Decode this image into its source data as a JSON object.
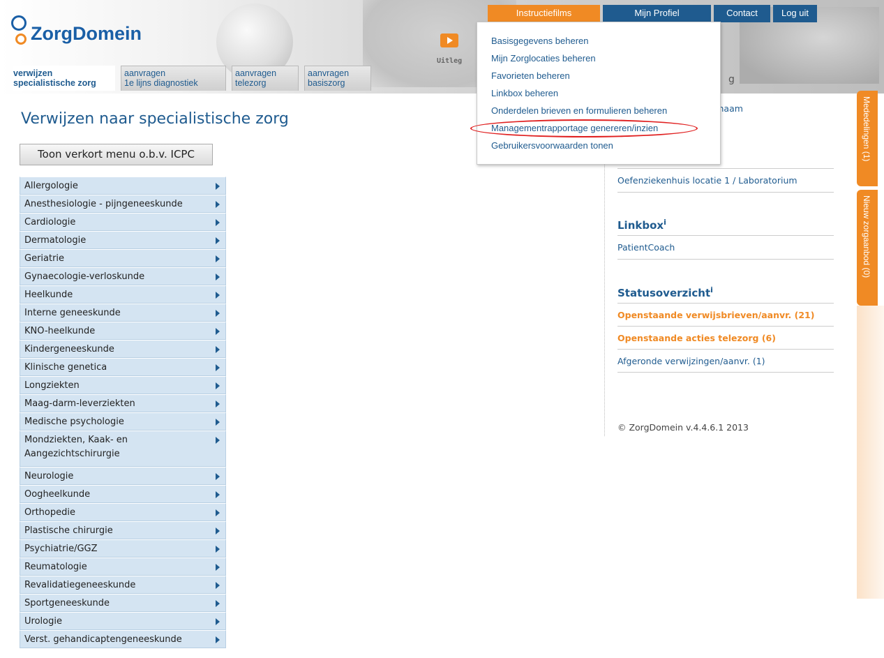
{
  "header": {
    "logo_text": "ZorgDomein",
    "uitleg_label": "Uitleg",
    "nav": {
      "instructiefilms": "Instructiefilms",
      "mijn_profiel": "Mijn Profiel",
      "contact": "Contact",
      "log_uit": "Log uit"
    },
    "tabs": [
      {
        "line1": "verwijzen",
        "line2": "specialistische zorg"
      },
      {
        "line1": "aanvragen",
        "line2": "1e lijns diagnostiek"
      },
      {
        "line1": "aanvragen",
        "line2": "telezorg"
      },
      {
        "line1": "aanvragen",
        "line2": "basiszorg"
      }
    ]
  },
  "main": {
    "title": "Verwijzen naar specialistische zorg",
    "icpc_button": "Toon verkort menu o.b.v. ICPC",
    "specialties": [
      "Allergologie",
      "Anesthesiologie - pijngeneeskunde",
      "Cardiologie",
      "Dermatologie",
      "Geriatrie",
      "Gynaecologie-verloskunde",
      "Heelkunde",
      "Interne geneeskunde",
      "KNO-heelkunde",
      "Kindergeneeskunde",
      "Klinische genetica",
      "Longziekten",
      "Maag-darm-leverziekten",
      "Medische psychologie",
      "Mondziekten, Kaak- en Aangezichtschirurgie",
      "Neurologie",
      "Oogheelkunde",
      "Orthopedie",
      "Plastische chirurgie",
      "Psychiatrie/GGZ",
      "Reumatologie",
      "Revalidatiegeneeskunde",
      "Sportgeneeskunde",
      "Urologie",
      "Verst. gehandicaptengeneeskunde"
    ]
  },
  "profile_menu": {
    "items": [
      "Basisgegevens beheren",
      "Mijn Zorglocaties beheren",
      "Favorieten beheren",
      "Linkbox beheren",
      "Onderdelen brieven en formulieren beheren",
      "Managementrapportage genereren/inzien",
      "Gebruikersvoorwaarden tonen"
    ]
  },
  "sidebar": {
    "partial_top": "snaam",
    "partial_lab_heading": "ek",
    "lab_item": "Oefenziekenhuis locatie 1 / Laboratorium",
    "linkbox_heading": "Linkbox",
    "linkbox_item": "PatientCoach",
    "status_heading": "Statusoverzicht",
    "status_items": [
      "Openstaande verwijsbrieven/aanvr. (21)",
      "Openstaande acties telezorg (6)",
      "Afgeronde verwijzingen/aanvr. (1)"
    ],
    "info_mark": "i",
    "copyright": "© ZorgDomein v.4.4.6.1 2013",
    "partial_behind_menu": "g"
  },
  "side_tabs": {
    "mededelingen": "Mededelingen (1)",
    "nieuw_zorgaanbod": "Nieuw zorgaanbod  (0)"
  },
  "colors": {
    "brand_blue": "#1f5b8f",
    "accent_orange": "#f08a24",
    "list_bg": "#d4e4f2",
    "highlight_red": "#e02020"
  }
}
